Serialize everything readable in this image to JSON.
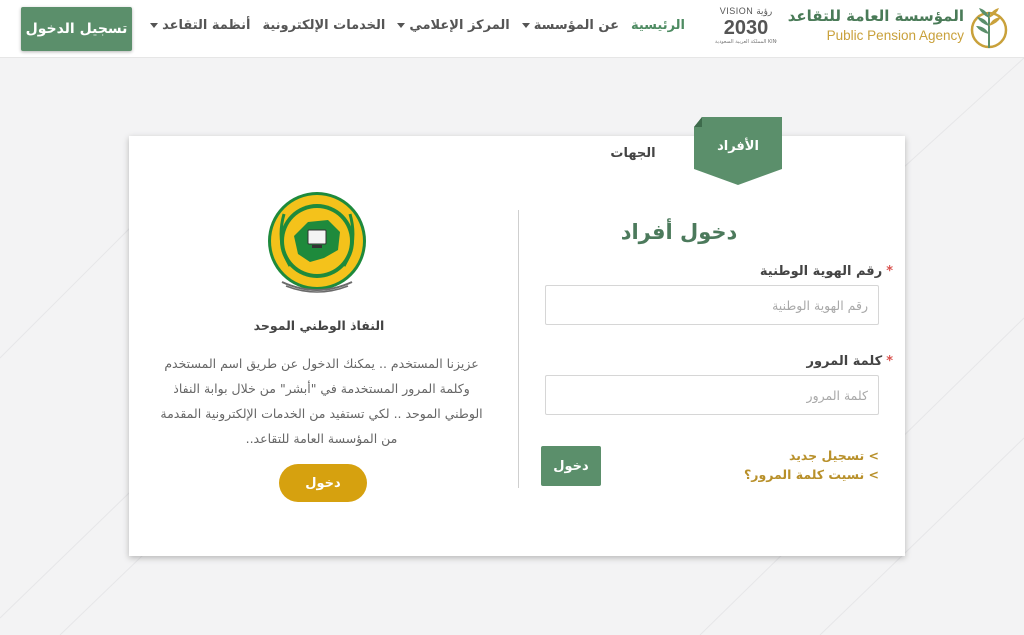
{
  "header": {
    "brand_ar": "المؤسسة العامة للتقاعد",
    "brand_en": "Public Pension Agency",
    "vision_top": "VISION رؤية",
    "vision_year": "2030",
    "vision_sub": "المملكة العربية السعودية KINGDOM OF SAUDI ARABIA",
    "nav": [
      {
        "label": "الرئيسية",
        "active": true,
        "dropdown": false
      },
      {
        "label": "عن المؤسسة",
        "active": false,
        "dropdown": true
      },
      {
        "label": "المركز الإعلامي",
        "active": false,
        "dropdown": true
      },
      {
        "label": "الخدمات الإلكترونية",
        "active": false,
        "dropdown": false
      },
      {
        "label": "أنظمة التقاعد",
        "active": false,
        "dropdown": true
      }
    ],
    "login_button": "تسجيل الدخول"
  },
  "tabs": {
    "individuals": "الأفراد",
    "entities": "الجهات"
  },
  "form": {
    "title": "دخول أفراد",
    "id_label": "رقم الهوية الوطنية",
    "id_placeholder": "رقم الهوية الوطنية",
    "password_label": "كلمة المرور",
    "password_placeholder": "كلمة المرور",
    "submit": "دخول",
    "links": [
      "> تسجيل جديد",
      "> نسيت كلمة المرور؟"
    ]
  },
  "nafath": {
    "title": "النفاذ الوطني الموحد",
    "description": "عزيزنا المستخدم .. يمكنك الدخول عن طريق اسم المستخدم وكلمة المرور المستخدمة في \"أبشر\" من خلال بوابة النفاذ الوطني الموحد .. لكي تستفيد من الخدمات الإلكترونية المقدمة من المؤسسة العامة للتقاعد..",
    "button": "دخول"
  },
  "colors": {
    "primary_green": "#5b8f6b",
    "title_green": "#4c7a5c",
    "gold": "#b8902a",
    "nafath_button": "#d6a10f",
    "required": "#d9534f"
  },
  "icons": {
    "brand": "wheat-logo-icon",
    "nafath": "national-access-emblem-icon",
    "dropdown": "caret-down-icon"
  }
}
